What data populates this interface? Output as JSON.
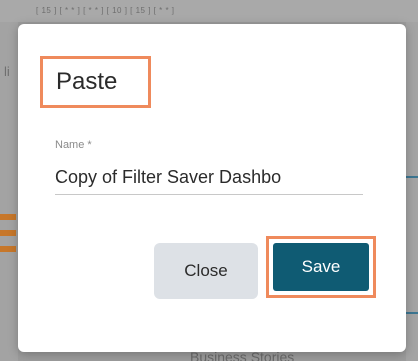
{
  "background": {
    "top_text": "[ 15 ]   [ * * ]   [ * * ]            [ 10 ]   [ 15 ]   [ * * ]",
    "left_text": "li",
    "bottom_text": "Business Stories"
  },
  "dialog": {
    "title": "Paste",
    "name_field": {
      "label": "Name *",
      "value": "Copy of Filter Saver Dashbo"
    },
    "buttons": {
      "close_label": "Close",
      "save_label": "Save"
    }
  },
  "colors": {
    "highlight_outline": "#ef8a5c",
    "save_button": "#0f5b73",
    "close_button": "#dde1e6"
  }
}
